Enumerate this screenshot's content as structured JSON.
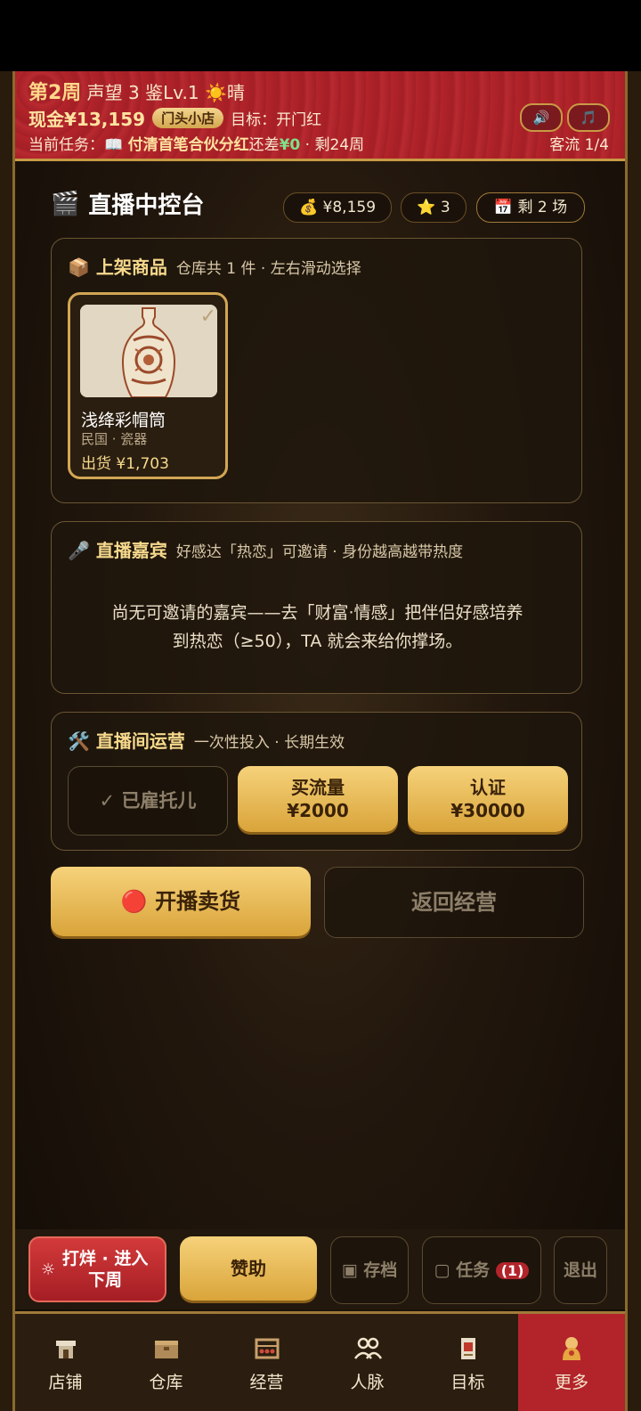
{
  "header": {
    "week": "第2周",
    "stats": "声望 3 鉴Lv.1 ☀️晴",
    "cash": "现金¥13,159",
    "shop_badge": "门头小店",
    "target": "目标：开门红",
    "task_prefix": "当前任务：📖",
    "task_name": "付清首笔合伙分红",
    "task_mid": "还差",
    "task_remaining": "¥0",
    "task_days": "· 剩24周",
    "customer_flow": "客流 1/4",
    "sound_icon": "🔊",
    "music_icon": "🎵"
  },
  "console": {
    "title": "直播中控台",
    "money": "¥8,159",
    "stars": "3",
    "sessions_left": "剩 2 场"
  },
  "goods": {
    "title": "上架商品",
    "subtitle": "仓库共 1 件 · 左右滑动选择",
    "item": {
      "name": "浅绛彩帽筒",
      "category": "民国 · 瓷器",
      "price": "出货 ¥1,703",
      "selected": true
    }
  },
  "guest": {
    "title": "直播嘉宾",
    "subtitle": "好感达「热恋」可邀请 · 身份越高越带热度",
    "message_line1": "尚无可邀请的嘉宾——去「财富·情感」把伴侣好感培养",
    "message_line2": "到热恋（≥50），TA 就会来给你撑场。"
  },
  "ops": {
    "title": "直播间运营",
    "subtitle": "一次性投入 · 长期生效",
    "hired": "✓ 已雇托儿",
    "traffic_label": "买流量",
    "traffic_price": "¥2000",
    "cert_label": "认证",
    "cert_price": "¥30000"
  },
  "actions": {
    "start_live": "🔴 开播卖货",
    "back": "返回经营"
  },
  "bottom_actions": {
    "next_week": "打烊 · 进入下周",
    "sponsor": "赞助",
    "save": "存档",
    "tasks": "任务",
    "task_count": "(1)",
    "quit": "退出"
  },
  "tabs": [
    "店铺",
    "仓库",
    "经营",
    "人脉",
    "目标",
    "更多"
  ],
  "colors": {
    "accent_gold": "#d9a43a",
    "header_red": "#a41f26",
    "active_tab": "#b3242a"
  }
}
